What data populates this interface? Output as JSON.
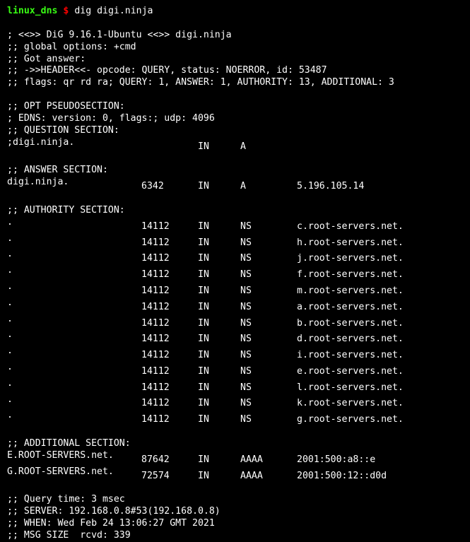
{
  "prompt": {
    "host": "linux_dns",
    "dollar": "$",
    "command": "dig digi.ninja"
  },
  "header": {
    "banner": "; <<>> DiG 9.16.1-Ubuntu <<>> digi.ninja",
    "options": ";; global options: +cmd",
    "got_answer": ";; Got answer:",
    "header_line": ";; ->>HEADER<<- opcode: QUERY, status: NOERROR, id: 53487",
    "flags": ";; flags: qr rd ra; QUERY: 1, ANSWER: 1, AUTHORITY: 13, ADDITIONAL: 3"
  },
  "pseudo": {
    "title": ";; OPT PSEUDOSECTION:",
    "edns": "; EDNS: version: 0, flags:; udp: 4096"
  },
  "question": {
    "title": ";; QUESTION SECTION:",
    "row": {
      "name": ";digi.ninja.",
      "ttl": "",
      "class": "IN",
      "type": "A",
      "data": ""
    }
  },
  "answer": {
    "title": ";; ANSWER SECTION:",
    "rows": [
      {
        "name": "digi.ninja.",
        "ttl": "6342",
        "class": "IN",
        "type": "A",
        "data": "5.196.105.14"
      }
    ]
  },
  "authority": {
    "title": ";; AUTHORITY SECTION:",
    "rows": [
      {
        "name": ".",
        "ttl": "14112",
        "class": "IN",
        "type": "NS",
        "data": "c.root-servers.net."
      },
      {
        "name": ".",
        "ttl": "14112",
        "class": "IN",
        "type": "NS",
        "data": "h.root-servers.net."
      },
      {
        "name": ".",
        "ttl": "14112",
        "class": "IN",
        "type": "NS",
        "data": "j.root-servers.net."
      },
      {
        "name": ".",
        "ttl": "14112",
        "class": "IN",
        "type": "NS",
        "data": "f.root-servers.net."
      },
      {
        "name": ".",
        "ttl": "14112",
        "class": "IN",
        "type": "NS",
        "data": "m.root-servers.net."
      },
      {
        "name": ".",
        "ttl": "14112",
        "class": "IN",
        "type": "NS",
        "data": "a.root-servers.net."
      },
      {
        "name": ".",
        "ttl": "14112",
        "class": "IN",
        "type": "NS",
        "data": "b.root-servers.net."
      },
      {
        "name": ".",
        "ttl": "14112",
        "class": "IN",
        "type": "NS",
        "data": "d.root-servers.net."
      },
      {
        "name": ".",
        "ttl": "14112",
        "class": "IN",
        "type": "NS",
        "data": "i.root-servers.net."
      },
      {
        "name": ".",
        "ttl": "14112",
        "class": "IN",
        "type": "NS",
        "data": "e.root-servers.net."
      },
      {
        "name": ".",
        "ttl": "14112",
        "class": "IN",
        "type": "NS",
        "data": "l.root-servers.net."
      },
      {
        "name": ".",
        "ttl": "14112",
        "class": "IN",
        "type": "NS",
        "data": "k.root-servers.net."
      },
      {
        "name": ".",
        "ttl": "14112",
        "class": "IN",
        "type": "NS",
        "data": "g.root-servers.net."
      }
    ]
  },
  "additional": {
    "title": ";; ADDITIONAL SECTION:",
    "rows": [
      {
        "name": "E.ROOT-SERVERS.net.",
        "ttl": "87642",
        "class": "IN",
        "type": "AAAA",
        "data": "2001:500:a8::e"
      },
      {
        "name": "G.ROOT-SERVERS.net.",
        "ttl": "72574",
        "class": "IN",
        "type": "AAAA",
        "data": "2001:500:12::d0d"
      }
    ]
  },
  "footer": {
    "query_time": ";; Query time: 3 msec",
    "server": ";; SERVER: 192.168.0.8#53(192.168.0.8)",
    "when": ";; WHEN: Wed Feb 24 13:06:27 GMT 2021",
    "msg_size": ";; MSG SIZE  rcvd: 339"
  }
}
